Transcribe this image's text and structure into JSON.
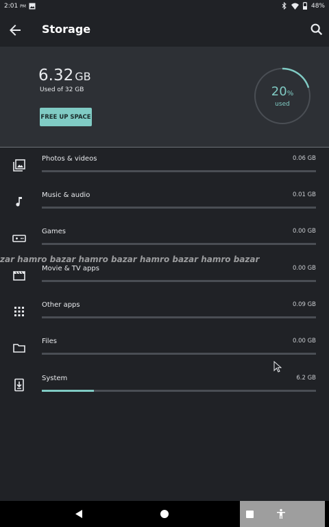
{
  "status_bar": {
    "time": "2:01",
    "time_suffix": "PM",
    "battery": "48%"
  },
  "app_bar": {
    "title": "Storage"
  },
  "summary": {
    "used_value": "6.32",
    "used_unit": "GB",
    "used_of": "Used of 32 GB",
    "free_button": "FREE UP SPACE",
    "percent_value": "20",
    "percent_sign": "%",
    "percent_label": "used",
    "percent_fraction": 0.2
  },
  "categories": [
    {
      "name": "Photos & videos",
      "size": "0.06 GB",
      "icon": "photos-icon",
      "fill": 0.0
    },
    {
      "name": "Music & audio",
      "size": "0.01 GB",
      "icon": "music-note-icon",
      "fill": 0.0
    },
    {
      "name": "Games",
      "size": "0.00 GB",
      "icon": "gamepad-icon",
      "fill": 0.0
    },
    {
      "name": "Movie & TV apps",
      "size": "0.00 GB",
      "icon": "movie-icon",
      "fill": 0.0
    },
    {
      "name": "Other apps",
      "size": "0.09 GB",
      "icon": "apps-grid-icon",
      "fill": 0.0
    },
    {
      "name": "Files",
      "size": "0.00 GB",
      "icon": "folder-icon",
      "fill": 0.0
    },
    {
      "name": "System",
      "size": "6.2 GB",
      "icon": "system-update-icon",
      "fill": 0.19
    }
  ],
  "watermark": "zar hamro bazar hamro bazar hamro bazar hamro bazar",
  "colors": {
    "accent": "#80cbc4",
    "background": "#202226",
    "panel": "#2d3035"
  }
}
